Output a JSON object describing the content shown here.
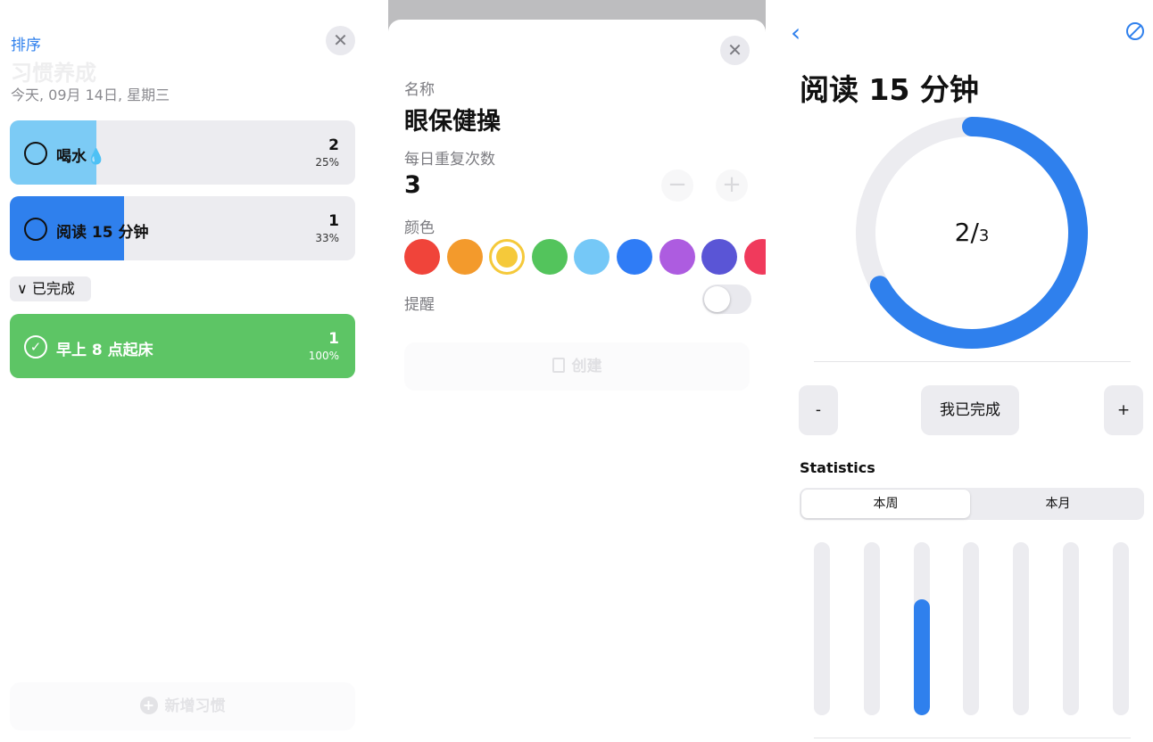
{
  "panel_list": {
    "sort_label": "排序",
    "title": "习惯养成",
    "date": "今天, 09月 14日, 星期三",
    "habits": [
      {
        "name": "喝水",
        "emoji": "💧",
        "count": "2",
        "percent": "25%",
        "progress": 0.25,
        "color": "#7ccbf5"
      },
      {
        "name": "阅读 15 分钟",
        "emoji": "",
        "count": "1",
        "percent": "33%",
        "progress": 0.33,
        "color": "#2f80ed"
      }
    ],
    "completed_label": "已完成",
    "completed": [
      {
        "name": "早上 8 点起床",
        "count": "1",
        "percent": "100%",
        "progress": 1.0,
        "color": "#5dc565"
      }
    ],
    "new_habit_label": "新增习惯"
  },
  "panel_create": {
    "name_label": "名称",
    "name_value": "眼保健操",
    "repeat_label": "每日重复次数",
    "repeat_value": "3",
    "minus_label": "−",
    "plus_label": "+",
    "color_label": "颜色",
    "colors": [
      "#f0443a",
      "#f39a2c",
      "#f5c93a",
      "#53c45c",
      "#75c8f7",
      "#2f7cf6",
      "#ad5ce0",
      "#5a55d6",
      "#f03a5c"
    ],
    "selected_color": "#f5c93a",
    "reminder_label": "提醒",
    "reminder_on": false,
    "create_label": "创建"
  },
  "panel_detail": {
    "title": "阅读 15 分钟",
    "progress_done": "2",
    "progress_total": "3",
    "progress_color": "#2f80ed",
    "minus_label": "-",
    "done_label": "我已完成",
    "plus_label": "+",
    "statistics_label": "Statistics",
    "segments": [
      "本周",
      "本月"
    ],
    "active_segment": "本周",
    "week_fill": [
      0,
      0,
      0.67,
      0,
      0,
      0,
      0
    ]
  }
}
